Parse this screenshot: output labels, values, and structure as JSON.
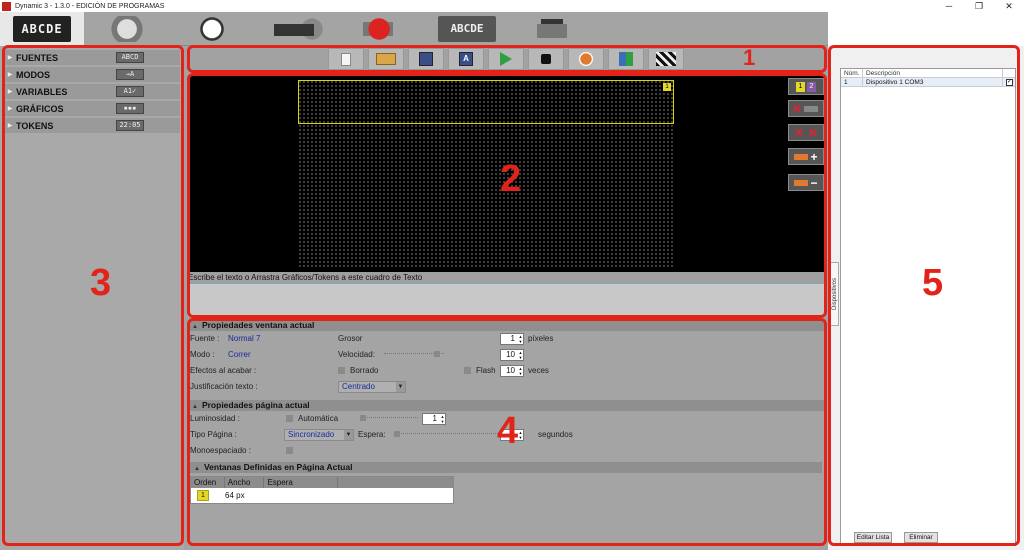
{
  "window": {
    "title": "Dynamic 3 - 1.3.0 - EDICIÓN DE PROGRAMAS",
    "minimize": "─",
    "restore": "❐",
    "close": "✕"
  },
  "top_tabs": [
    {
      "icon": "abcde-sign-icon",
      "text": "ABCDE"
    },
    {
      "icon": "gear-wheel-icon",
      "text": ""
    },
    {
      "icon": "clock-icon",
      "text": ""
    },
    {
      "icon": "sign-settings-icon",
      "text": ""
    },
    {
      "icon": "d-logo-icon",
      "text": ""
    },
    {
      "icon": "abcde-edit-icon",
      "text": "ABCDE"
    },
    {
      "icon": "printer-icon",
      "text": ""
    }
  ],
  "left_panel": {
    "items": [
      {
        "label": "FUENTES",
        "badge": "ABCD"
      },
      {
        "label": "MODOS",
        "badge": "→A"
      },
      {
        "label": "VARIABLES",
        "badge": "A1✓"
      },
      {
        "label": "GRÁFICOS",
        "badge": "▪▪▪"
      },
      {
        "label": "TOKENS",
        "badge": "22:05"
      }
    ]
  },
  "toolbar": {
    "buttons": [
      "new-file",
      "open-folder",
      "save",
      "save-as",
      "play",
      "stop",
      "check",
      "preview",
      "clapper"
    ],
    "saveas_letter": "A"
  },
  "editor": {
    "window_number": "1",
    "page_1": "1",
    "page_2": "2",
    "hint": "Escribe el texto o Arrastra Gráficos/Tokens a este cuadro de Texto"
  },
  "props_window": {
    "header": "Propiedades ventana actual",
    "fuente_label": "Fuente :",
    "fuente_value": "Normal 7",
    "modo_label": "Modo :",
    "modo_value": "Correr",
    "efectos_label": "Efectos al acabar :",
    "just_label": "Justificación texto :",
    "just_value": "Centrado",
    "grosor_label": "Grosor",
    "grosor_value": "1",
    "pixeles": "píxeles",
    "velocidad_label": "Velocidad:",
    "velocidad_value": "10",
    "borrado": "Borrado",
    "flash": "Flash",
    "flash_value": "10",
    "veces": "veces"
  },
  "props_page": {
    "header": "Propiedades página actual",
    "lum_label": "Luminosidad :",
    "automatica": "Automática",
    "lum_value": "1",
    "tipo_label": "Tipo Página :",
    "tipo_value": "Sincronizado",
    "espera_label": "Espera:",
    "espera_value": "1",
    "segundos": "segundos",
    "mono_label": "Monoespaciado :"
  },
  "windows_table": {
    "header": "Ventanas Definidas en Página Actual",
    "columns": [
      "Orden",
      "Ancho",
      "Espera"
    ],
    "rows": [
      {
        "orden": "1",
        "ancho": "64 px",
        "espera": ""
      }
    ]
  },
  "devices": {
    "columns": [
      "Núm.",
      "Descripción"
    ],
    "rows": [
      {
        "num": "1",
        "desc": "Dispositivo 1 COM3",
        "checked": "✓"
      }
    ],
    "side_tab": "Dispositivos",
    "edit_button": "Editar Lista",
    "delete_button": "Eliminar"
  },
  "annotations": [
    "1",
    "2",
    "3",
    "4",
    "5"
  ],
  "colors": {
    "annotation": "#e2231a",
    "led_highlight": "#e3d72a",
    "value_text": "#1a2a9b"
  }
}
